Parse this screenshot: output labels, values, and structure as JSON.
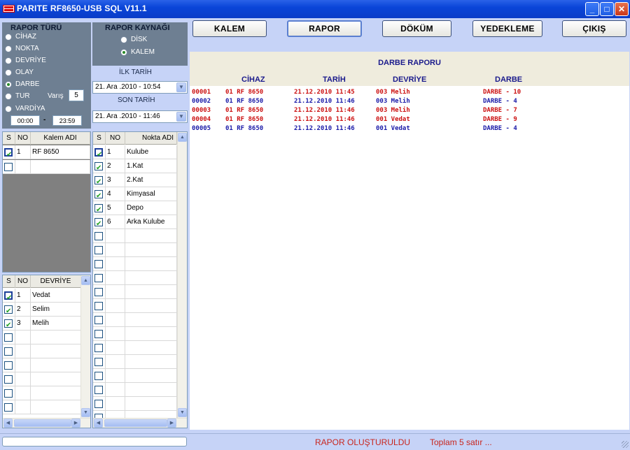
{
  "window": {
    "title": "PARITE RF8650-USB SQL V11.1"
  },
  "toolbar": {
    "kalem": "KALEM",
    "rapor": "RAPOR",
    "dokum": "DÖKÜM",
    "yedekleme": "YEDEKLEME",
    "cikis": "ÇIKIŞ"
  },
  "rapor_turu": {
    "title": "RAPOR TÜRÜ",
    "options": [
      "CİHAZ",
      "NOKTA",
      "DEVRİYE",
      "OLAY",
      "DARBE",
      "TUR",
      "VARDİYA"
    ],
    "selected": "DARBE",
    "varis_label": "Varış",
    "varis_value": "5",
    "time_from": "00:00",
    "time_to": "23:59",
    "time_sep": "-"
  },
  "rapor_kaynagi": {
    "title": "RAPOR KAYNAĞI",
    "options": [
      "DİSK",
      "KALEM"
    ],
    "selected": "KALEM"
  },
  "dates": {
    "ilk_label": "İLK TARİH",
    "ilk_value": "21. Ara .2010 - 10:54",
    "son_label": "SON TARİH",
    "son_value": "21. Ara .2010 - 11:46"
  },
  "kalem_grid": {
    "headers": [
      "S",
      "NO",
      "Kalem ADI"
    ],
    "rows": [
      {
        "checked": true,
        "no": "1",
        "name": "RF 8650"
      }
    ]
  },
  "devriye_grid": {
    "headers": [
      "S",
      "NO",
      "DEVRİYE"
    ],
    "rows": [
      {
        "checked": true,
        "no": "1",
        "name": "Vedat"
      },
      {
        "checked": true,
        "no": "2",
        "name": "Selim"
      },
      {
        "checked": true,
        "no": "3",
        "name": "Melih"
      }
    ]
  },
  "nokta_grid": {
    "headers": [
      "S",
      "NO",
      "Nokta ADI"
    ],
    "rows": [
      {
        "checked": true,
        "no": "1",
        "name": "Kulube"
      },
      {
        "checked": true,
        "no": "2",
        "name": "1.Kat"
      },
      {
        "checked": true,
        "no": "3",
        "name": "2.Kat"
      },
      {
        "checked": true,
        "no": "4",
        "name": "Kimyasal"
      },
      {
        "checked": true,
        "no": "5",
        "name": "Depo"
      },
      {
        "checked": true,
        "no": "6",
        "name": "Arka Kulube"
      }
    ]
  },
  "report": {
    "title": "DARBE RAPORU",
    "columns": [
      "CİHAZ",
      "TARİH",
      "DEVRİYE",
      "DARBE"
    ],
    "colors": {
      "red": "#cc1111",
      "blue": "#1a1aa8"
    },
    "rows": [
      {
        "id": "00001",
        "cihaz": "01 RF 8650",
        "tarih": "21.12.2010 11:45",
        "devriye": "003 Melih",
        "darbe": "DARBE - 10",
        "color": "red"
      },
      {
        "id": "00002",
        "cihaz": "01 RF 8650",
        "tarih": "21.12.2010 11:46",
        "devriye": "003 Melih",
        "darbe": "DARBE - 4",
        "color": "blue"
      },
      {
        "id": "00003",
        "cihaz": "01 RF 8650",
        "tarih": "21.12.2010 11:46",
        "devriye": "003 Melih",
        "darbe": "DARBE - 7",
        "color": "red"
      },
      {
        "id": "00004",
        "cihaz": "01 RF 8650",
        "tarih": "21.12.2010 11:46",
        "devriye": "001 Vedat",
        "darbe": "DARBE - 9",
        "color": "red"
      },
      {
        "id": "00005",
        "cihaz": "01 RF 8650",
        "tarih": "21.12.2010 11:46",
        "devriye": "001 Vedat",
        "darbe": "DARBE - 4",
        "color": "blue"
      }
    ]
  },
  "status": {
    "message": "RAPOR OLUŞTURULDU",
    "count": "Toplam 5 satır ..."
  }
}
